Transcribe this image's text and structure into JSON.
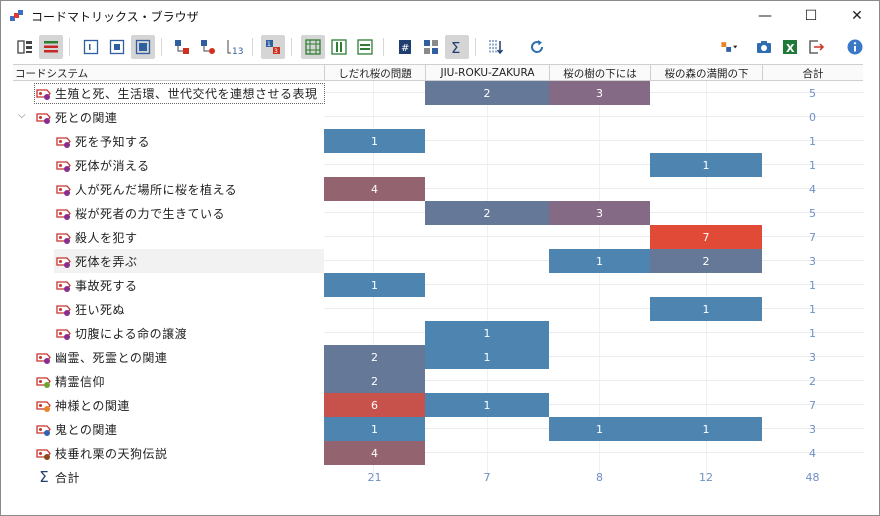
{
  "window": {
    "title": "コードマトリックス・ブラウザ",
    "minimize": "—",
    "maximize": "☐",
    "close": "✕"
  },
  "toolbar": {
    "left": [
      "bars-icon",
      "list-stripes-icon",
      "frame-small-icon",
      "frame-medium-icon",
      "frame-large-icon",
      "tree-nodes-icon",
      "node-branch-icon",
      "numbered-sort-icon",
      "numbered-grid-icon",
      "hash-grid-icon",
      "columns-icon",
      "rows-icon",
      "hash-icon",
      "counter-icon",
      "sigma-icon",
      "sort-down-icon",
      "refresh-icon"
    ],
    "right": [
      "settings-dropdown-icon",
      "camera-icon",
      "excel-icon",
      "export-icon",
      "info-icon"
    ],
    "active": [
      "list-stripes-icon",
      "frame-large-icon",
      "hash-grid-icon",
      "sigma-icon"
    ]
  },
  "colors": {
    "blue": "#4d84b0",
    "slate": "#667898",
    "mauve": "#846a85",
    "plum": "#936370",
    "red": "#e04a36",
    "brick": "#c6524b",
    "sum": "#6e8fc7"
  },
  "matrix": {
    "header_code_system": "コードシステム",
    "columns": [
      "しだれ桜の問題",
      "JIU-ROKU-ZAKURA",
      "桜の樹の下には",
      "桜の森の満開の下",
      "合計"
    ],
    "rows": [
      {
        "label": "生殖と死、生活環、世代交代を連想させる表現",
        "indent": 0,
        "dot": "#8b2c8f",
        "cells": [
          null,
          {
            "v": "2",
            "c": "slate"
          },
          {
            "v": "3",
            "c": "mauve"
          },
          null
        ],
        "total": "5",
        "focus": true
      },
      {
        "label": "死との関連",
        "indent": 0,
        "dot": "#8b2c8f",
        "expanded": true,
        "cells": [
          null,
          null,
          null,
          null
        ],
        "total": "0"
      },
      {
        "label": "死を予知する",
        "indent": 1,
        "dot": "#8b2c8f",
        "cells": [
          {
            "v": "1",
            "c": "blue"
          },
          null,
          null,
          null
        ],
        "total": "1"
      },
      {
        "label": "死体が消える",
        "indent": 1,
        "dot": "#8b2c8f",
        "cells": [
          null,
          null,
          null,
          {
            "v": "1",
            "c": "blue"
          }
        ],
        "total": "1"
      },
      {
        "label": "人が死んだ場所に桜を植える",
        "indent": 1,
        "dot": "#8b2c8f",
        "cells": [
          {
            "v": "4",
            "c": "plum"
          },
          null,
          null,
          null
        ],
        "total": "4"
      },
      {
        "label": "桜が死者の力で生きている",
        "indent": 1,
        "dot": "#8b2c8f",
        "cells": [
          null,
          {
            "v": "2",
            "c": "slate"
          },
          {
            "v": "3",
            "c": "mauve"
          },
          null
        ],
        "total": "5"
      },
      {
        "label": "殺人を犯す",
        "indent": 1,
        "dot": "#8b2c8f",
        "cells": [
          null,
          null,
          null,
          {
            "v": "7",
            "c": "red"
          }
        ],
        "total": "7"
      },
      {
        "label": "死体を弄ぶ",
        "indent": 1,
        "dot": "#8b2c8f",
        "cells": [
          null,
          null,
          {
            "v": "1",
            "c": "blue"
          },
          {
            "v": "2",
            "c": "slate"
          }
        ],
        "total": "3",
        "selected": true
      },
      {
        "label": "事故死する",
        "indent": 1,
        "dot": "#8b2c8f",
        "cells": [
          {
            "v": "1",
            "c": "blue"
          },
          null,
          null,
          null
        ],
        "total": "1"
      },
      {
        "label": "狂い死ぬ",
        "indent": 1,
        "dot": "#8b2c8f",
        "cells": [
          null,
          null,
          null,
          {
            "v": "1",
            "c": "blue"
          }
        ],
        "total": "1"
      },
      {
        "label": "切腹による命の譲渡",
        "indent": 1,
        "dot": "#8b2c8f",
        "cells": [
          null,
          {
            "v": "1",
            "c": "blue"
          },
          null,
          null
        ],
        "total": "1"
      },
      {
        "label": "幽霊、死霊との関連",
        "indent": 0,
        "dot": "#8b2c8f",
        "cells": [
          {
            "v": "2",
            "c": "slate"
          },
          {
            "v": "1",
            "c": "blue"
          },
          null,
          null
        ],
        "total": "3"
      },
      {
        "label": "精霊信仰",
        "indent": 0,
        "dot": "#6aa62e",
        "cells": [
          {
            "v": "2",
            "c": "slate"
          },
          null,
          null,
          null
        ],
        "total": "2"
      },
      {
        "label": "神様との関連",
        "indent": 0,
        "dot": "#e8822a",
        "cells": [
          {
            "v": "6",
            "c": "brick"
          },
          {
            "v": "1",
            "c": "blue"
          },
          null,
          null
        ],
        "total": "7"
      },
      {
        "label": "鬼との関連",
        "indent": 0,
        "dot": "#2f62b5",
        "cells": [
          {
            "v": "1",
            "c": "blue"
          },
          null,
          {
            "v": "1",
            "c": "blue"
          },
          {
            "v": "1",
            "c": "blue"
          }
        ],
        "total": "3"
      },
      {
        "label": "枝垂れ栗の天狗伝説",
        "indent": 0,
        "dot": "#8a4b1c",
        "cells": [
          {
            "v": "4",
            "c": "plum"
          },
          null,
          null,
          null
        ],
        "total": "4"
      }
    ],
    "totals": {
      "label": "合計",
      "values": [
        "21",
        "7",
        "8",
        "12",
        "48"
      ]
    }
  }
}
